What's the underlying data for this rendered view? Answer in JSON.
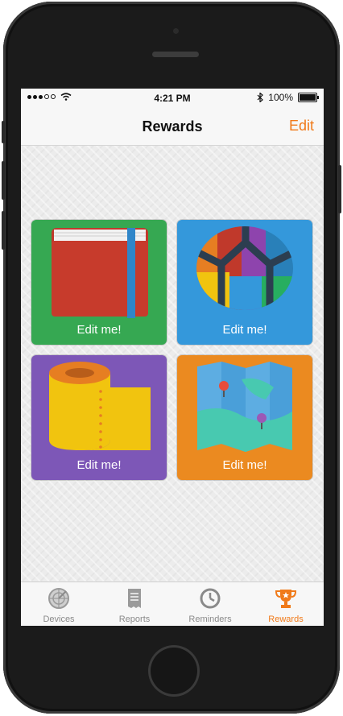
{
  "status_bar": {
    "time": "4:21 PM",
    "battery": "100%"
  },
  "nav": {
    "title": "Rewards",
    "edit_label": "Edit"
  },
  "rewards": [
    {
      "label": "Edit me!",
      "icon": "notebook-icon",
      "bg": "#36a852"
    },
    {
      "label": "Edit me!",
      "icon": "globe-icon",
      "bg": "#3498db"
    },
    {
      "label": "Edit me!",
      "icon": "toilet-paper-icon",
      "bg": "#7d57b7"
    },
    {
      "label": "Edit me!",
      "icon": "map-icon",
      "bg": "#eb8a20"
    }
  ],
  "tabs": [
    {
      "label": "Devices",
      "icon": "radar-icon"
    },
    {
      "label": "Reports",
      "icon": "receipt-icon"
    },
    {
      "label": "Reminders",
      "icon": "clock-icon"
    },
    {
      "label": "Rewards",
      "icon": "trophy-icon",
      "active": true
    }
  ],
  "colors": {
    "accent": "#f07a1a"
  }
}
